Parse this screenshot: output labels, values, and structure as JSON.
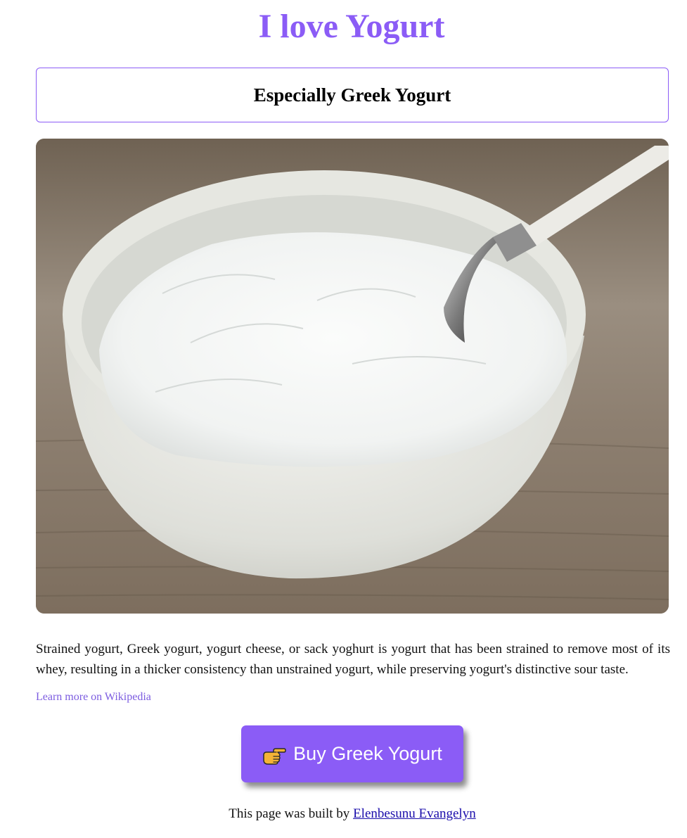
{
  "header": {
    "title": "I love Yogurt",
    "subtitle": "Especially Greek Yogurt"
  },
  "image": {
    "icon": "yogurt-bowl-photo"
  },
  "content": {
    "description": "Strained yogurt, Greek yogurt, yogurt cheese, or sack yoghurt is yogurt that has been strained to remove most of its whey, resulting in a thicker consistency than unstrained yogurt, while preserving yogurt's distinctive sour taste.",
    "wiki_link": "Learn more on Wikipedia"
  },
  "cta": {
    "label": "Buy Greek Yogurt",
    "icon": "pointing-hand-icon"
  },
  "footer": {
    "prefix": "This page was built by",
    "author": "Elenbesunu Evangelyn"
  },
  "colors": {
    "accent": "#8b5cf6",
    "link": "#7c5ce0",
    "author_link": "#1a0dab"
  }
}
